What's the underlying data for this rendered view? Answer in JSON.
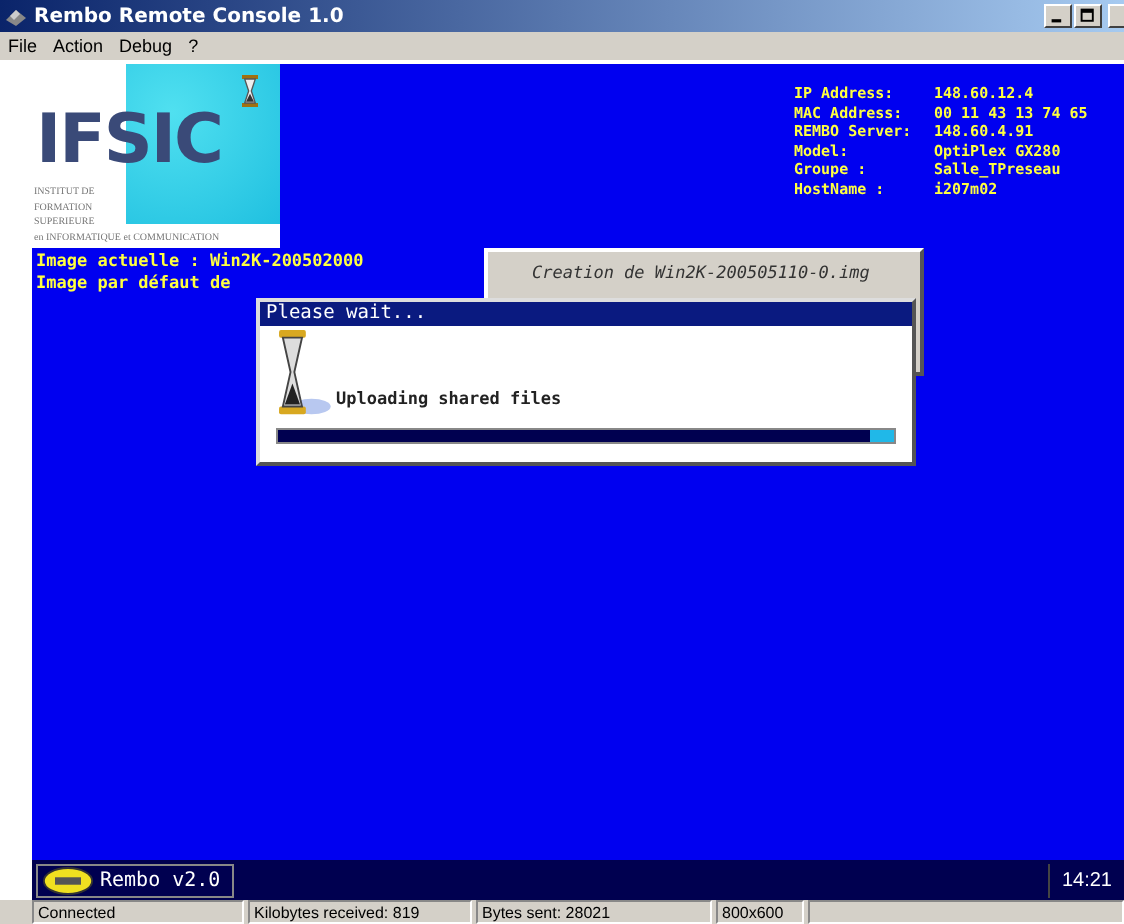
{
  "window": {
    "title": "Rembo Remote Console 1.0"
  },
  "menu": [
    "File",
    "Action",
    "Debug",
    "?"
  ],
  "logo": {
    "brand": "IFSIC",
    "lines": [
      "INSTITUT DE",
      "FORMATION",
      "SUPERIEURE",
      "en INFORMATIQUE et COMMUNICATION"
    ]
  },
  "info": [
    {
      "label": "IP Address:",
      "value": "148.60.12.4"
    },
    {
      "label": "MAC Address:",
      "value": "00 11 43 13 74 65"
    },
    {
      "label": "REMBO Server:",
      "value": "148.60.4.91"
    },
    {
      "label": "Model:",
      "value": "OptiPlex GX280"
    },
    {
      "label": "Groupe :",
      "value": "Salle_TPreseau"
    },
    {
      "label": "HostName :",
      "value": "i207m02"
    }
  ],
  "console_lines": [
    "Image actuelle : Win2K-200502000",
    "Image par défaut de"
  ],
  "background_window": {
    "title": "Creation de Win2K-200505110-0.img"
  },
  "dialog": {
    "title": "Please wait...",
    "message": "Uploading shared files",
    "level": 0.96
  },
  "taskbar": {
    "start": "Rembo v2.0",
    "clock": "14:21"
  },
  "status_bar": [
    "Connected",
    "Kilobytes received: 819",
    "Bytes sent: 28021",
    "800x600"
  ]
}
